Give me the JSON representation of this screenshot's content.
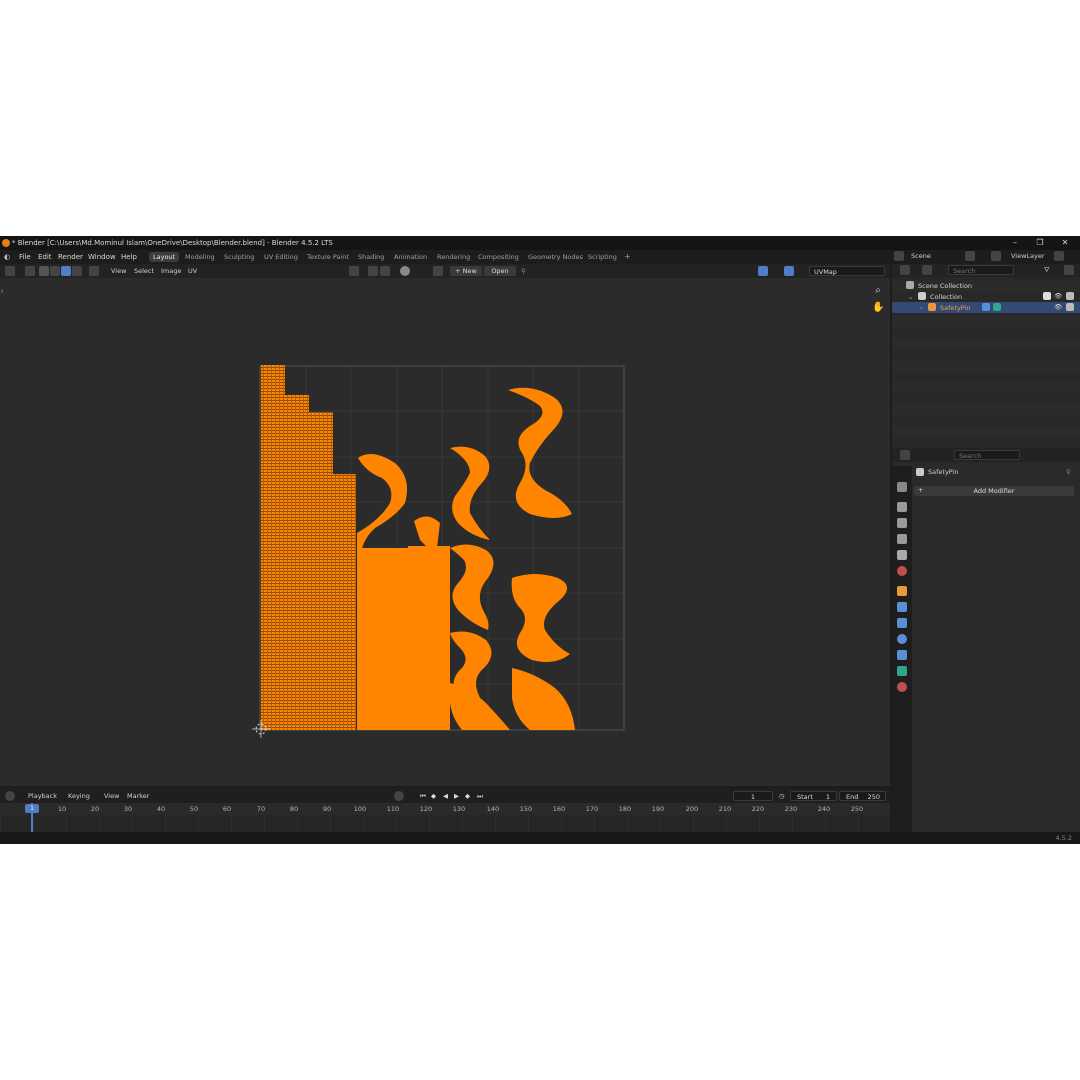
{
  "window": {
    "title": "* Blender [C:\\Users\\Md.Mominul Islam\\OneDrive\\Desktop\\Blender.blend] - Blender 4.5.2 LTS",
    "controls": [
      "–",
      "❐",
      "✕"
    ]
  },
  "menu": {
    "items": [
      "File",
      "Edit",
      "Render",
      "Window",
      "Help"
    ],
    "workspaces": [
      "Layout",
      "Modeling",
      "Sculpting",
      "UV Editing",
      "Texture Paint",
      "Shading",
      "Animation",
      "Rendering",
      "Compositing",
      "Geometry Nodes",
      "Scripting"
    ],
    "active_workspace": "Layout",
    "add_label": "+",
    "scene_label": "Scene",
    "viewlayer_label": "ViewLayer"
  },
  "uv_header": {
    "menus": [
      "View",
      "Select",
      "Image",
      "UV"
    ],
    "new_label": "+  New",
    "open_label": "Open",
    "uvmap_value": "UVMap"
  },
  "viewport": {
    "uv_color": "#ff8500",
    "grid_color": "#3a3a3a",
    "bg_color": "#2b2b2b"
  },
  "timeline": {
    "menus": [
      "Playback",
      "Keying",
      "View",
      "Marker"
    ],
    "current_frame": "1",
    "start_label": "Start",
    "start_value": "1",
    "end_label": "End",
    "end_value": "250",
    "ruler_current": "1",
    "ticks": [
      "10",
      "20",
      "30",
      "40",
      "50",
      "60",
      "70",
      "80",
      "90",
      "100",
      "110",
      "120",
      "130",
      "140",
      "150",
      "160",
      "170",
      "180",
      "190",
      "200",
      "210",
      "220",
      "230",
      "240",
      "250"
    ]
  },
  "outliner": {
    "search_placeholder": "Search",
    "scene_collection": "Scene Collection",
    "collection": "Collection",
    "object": "SafetyPin"
  },
  "properties": {
    "search_placeholder": "Search",
    "object_name": "SafetyPin",
    "add_modifier": "Add Modifier"
  },
  "status": {
    "version": "4.5.2"
  }
}
